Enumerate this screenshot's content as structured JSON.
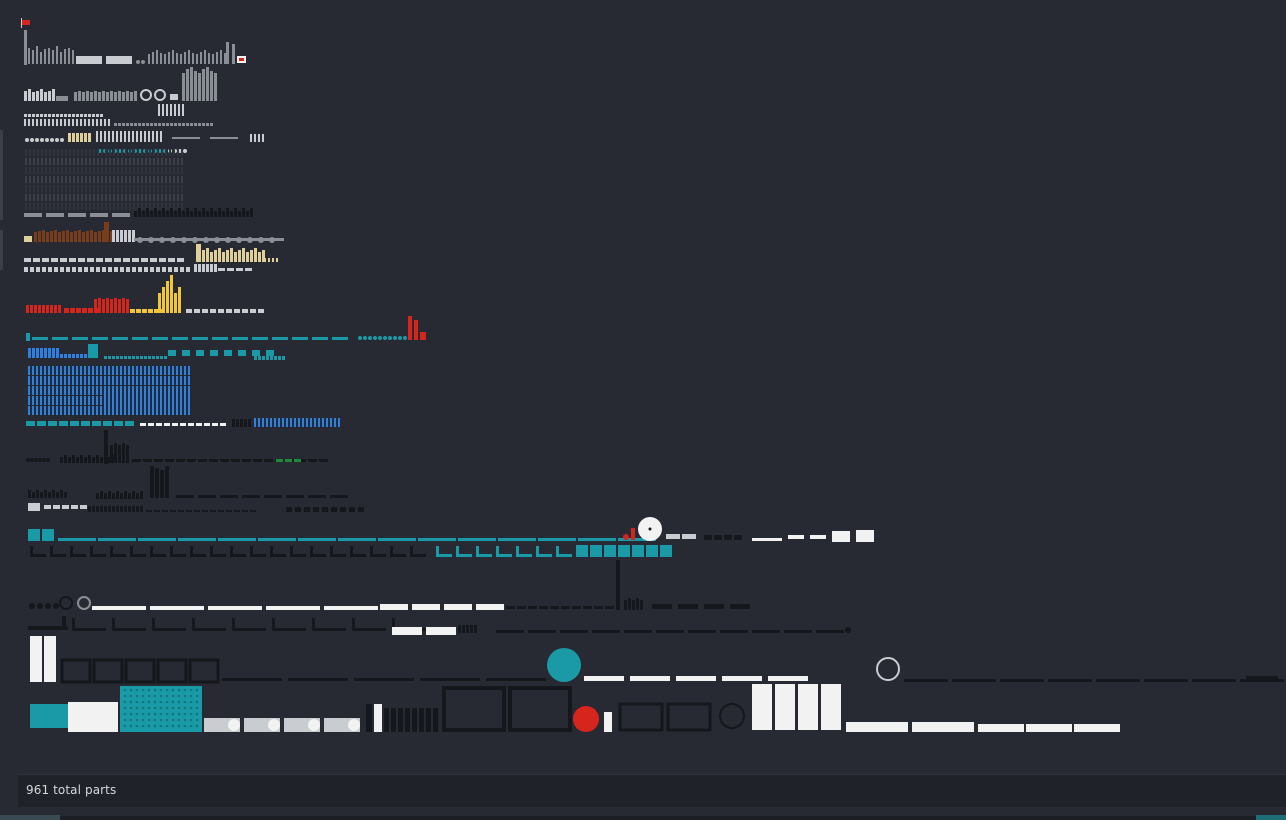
{
  "status": {
    "total_parts_label": "961 total parts"
  },
  "colors": {
    "background": "#272a32",
    "status_bar": "#1f2228",
    "status_text": "#d6d8dc",
    "part_gray": "#8a8f95",
    "part_light_gray": "#c9ccd0",
    "part_white": "#f2f2f2",
    "part_black": "#14171c",
    "part_teal": "#1a9aa6",
    "part_blue": "#2d7fe0",
    "part_red": "#d6251c",
    "part_yellow": "#f2c737",
    "part_brown": "#7a3d1c",
    "part_tan": "#e0cf98",
    "part_green": "#1e8a3e"
  },
  "icons": {
    "flag_marker": "flag-icon"
  }
}
